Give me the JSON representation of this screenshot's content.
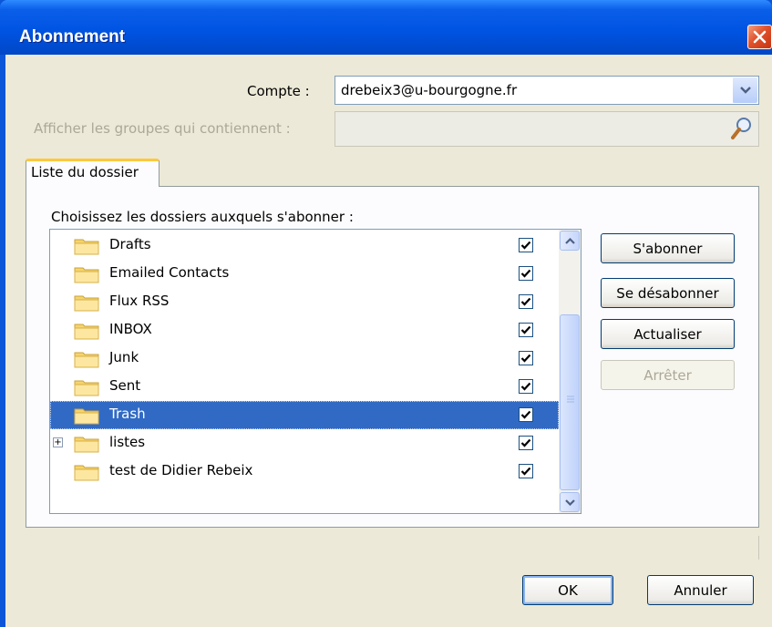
{
  "window": {
    "title": "Abonnement"
  },
  "account": {
    "label": "Compte :",
    "value": "drebeix3@u-bourgogne.fr"
  },
  "filter": {
    "label": "Afficher les groupes qui contiennent :",
    "value": ""
  },
  "tab": {
    "label": "Liste du dossier"
  },
  "folders": {
    "heading": "Choisissez les dossiers auxquels s'abonner :",
    "items": [
      {
        "name": "Drafts",
        "checked": true
      },
      {
        "name": "Emailed Contacts",
        "checked": true
      },
      {
        "name": "Flux RSS",
        "checked": true
      },
      {
        "name": "INBOX",
        "checked": true
      },
      {
        "name": "Junk",
        "checked": true
      },
      {
        "name": "Sent",
        "checked": true
      },
      {
        "name": "Trash",
        "checked": true,
        "selected": true
      },
      {
        "name": "listes",
        "checked": true,
        "expandable": true
      },
      {
        "name": "test de Didier Rebeix",
        "checked": true
      }
    ]
  },
  "actions": {
    "subscribe": "S'abonner",
    "unsubscribe": "Se désabonner",
    "refresh": "Actualiser",
    "stop": "Arrêter"
  },
  "footer": {
    "ok": "OK",
    "cancel": "Annuler"
  },
  "colors": {
    "titlebar": "#0054e3",
    "selection": "#316ac5",
    "client": "#ece9d8"
  }
}
